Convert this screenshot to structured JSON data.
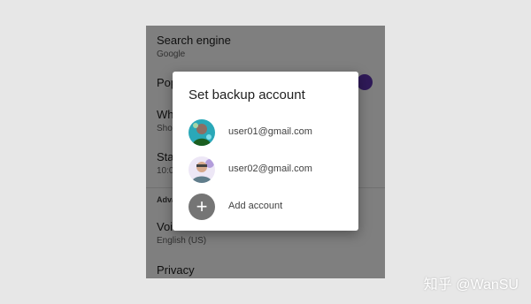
{
  "settings": {
    "search_engine": {
      "title": "Search engine",
      "value": "Google"
    },
    "popups": {
      "title_partial": "Pop"
    },
    "which": {
      "title_partial": "Wh",
      "value_partial": "Sho"
    },
    "start": {
      "title_partial": "Sta",
      "value_partial": "10:0"
    },
    "section_header_partial": "Adva",
    "voice_search": {
      "title": "Voice search",
      "value": "English (US)"
    },
    "privacy": {
      "title": "Privacy"
    }
  },
  "dialog": {
    "title": "Set backup account",
    "accounts": [
      {
        "email": "user01@gmail.com"
      },
      {
        "email": "user02@gmail.com"
      }
    ],
    "add_account_label": "Add account",
    "add_icon_glyph": "+"
  },
  "watermark": "知乎 @WanSU",
  "colors": {
    "accent": "#5e35b1",
    "scrim": "rgba(0,0,0,0.5)",
    "background": "#e7e7e7"
  },
  "icons": [
    "avatar-user01",
    "avatar-user02",
    "add-account-icon"
  ]
}
